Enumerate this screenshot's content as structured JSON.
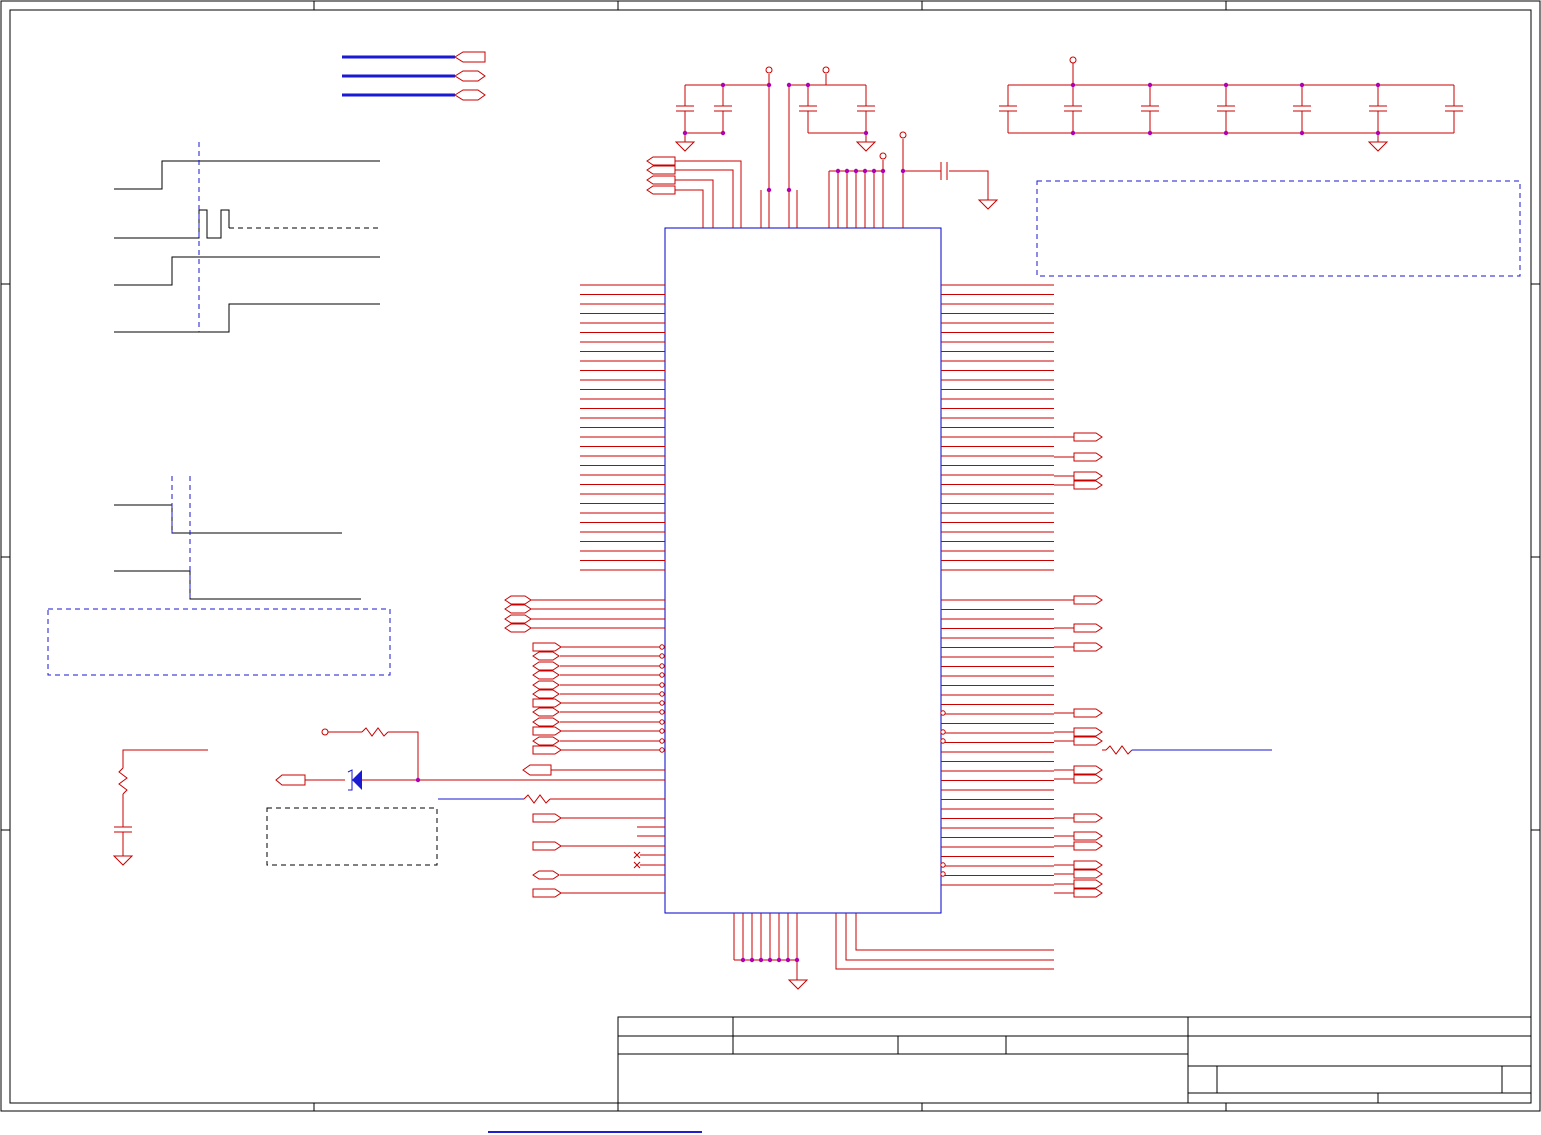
{
  "sheet": {
    "colors": {
      "frame": "#000000",
      "wire": "#c80000",
      "net_magenta": "#b000b0",
      "chip_border": "#0000c8",
      "bus_blue": "#1a1ad2",
      "dashed_box": "#1a1ad2",
      "junction": "#b000b0",
      "component": "#c80000",
      "timing": "#000000"
    },
    "icons": {
      "ground": "ground-symbol-icon",
      "capacitor": "capacitor-icon",
      "resistor": "resistor-icon",
      "diode": "zener-diode-icon",
      "port": "port-connector-icon",
      "no_connect": "no-connect-x-icon",
      "power_pin": "power-pin-circle-icon"
    }
  }
}
